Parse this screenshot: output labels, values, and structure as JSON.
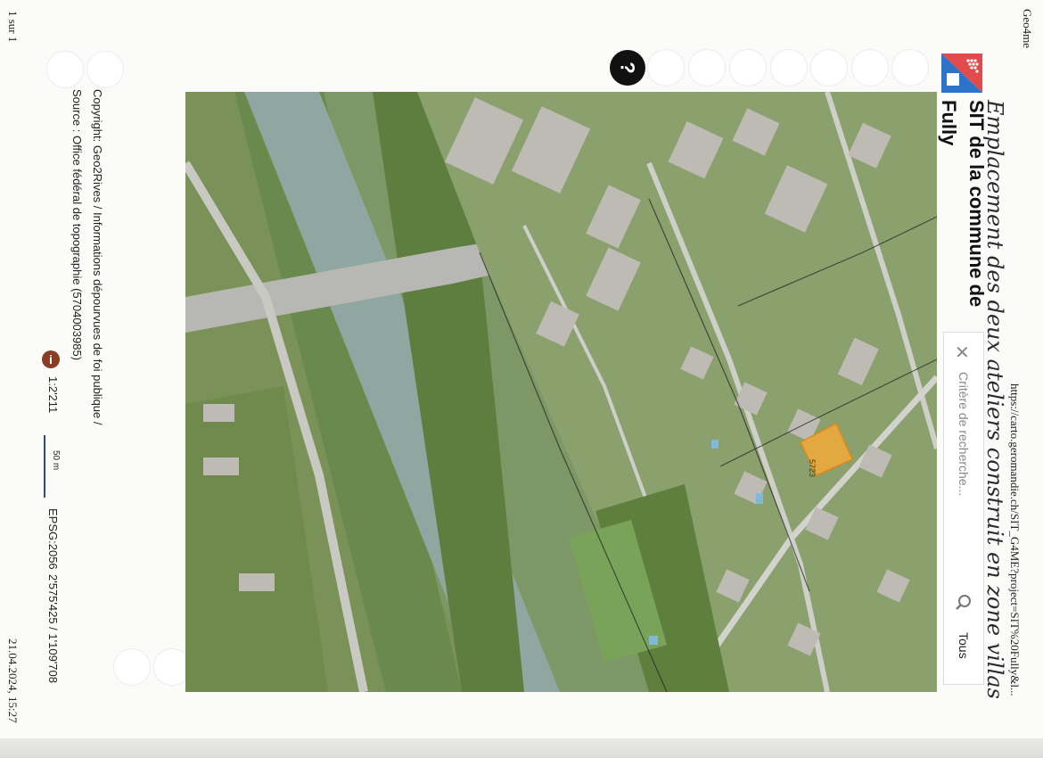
{
  "header": {
    "app_name": "Geo4me",
    "url": "https://carto.geromandie.ch/SIT_G4ME?project=SIT%20Fully&l...",
    "page_count": "1 sur 1",
    "printed_at": "21.04.2024, 15:27"
  },
  "annotation": {
    "handwritten_note": "Emplacement des deux ateliers construit en zone villas"
  },
  "app": {
    "title": "SIT de la commune de",
    "subtitle": "Fully",
    "help_label": "?"
  },
  "search": {
    "placeholder": "Critère de recherche...",
    "scope_label": "Tous",
    "clear_icon": "close-icon",
    "search_icon": "search-icon"
  },
  "footer": {
    "copyright": "Copyright: Geo2Rives / Informations dépourvues de foi publique /",
    "source": "Source : Office fédéral de topographie (5704003985)",
    "info_icon": "info-icon",
    "scale": "1:2'211",
    "scalebar_label": "50 m",
    "epsg": "EPSG:2056",
    "coordinates": "2'575'425 / 1'109'708"
  },
  "map": {
    "parcel_label": "5723",
    "highlight_color": "#f2a93b",
    "river_color": "#8fa7a0",
    "logo_colors": [
      "#e24b4b",
      "#2b74c9"
    ]
  }
}
